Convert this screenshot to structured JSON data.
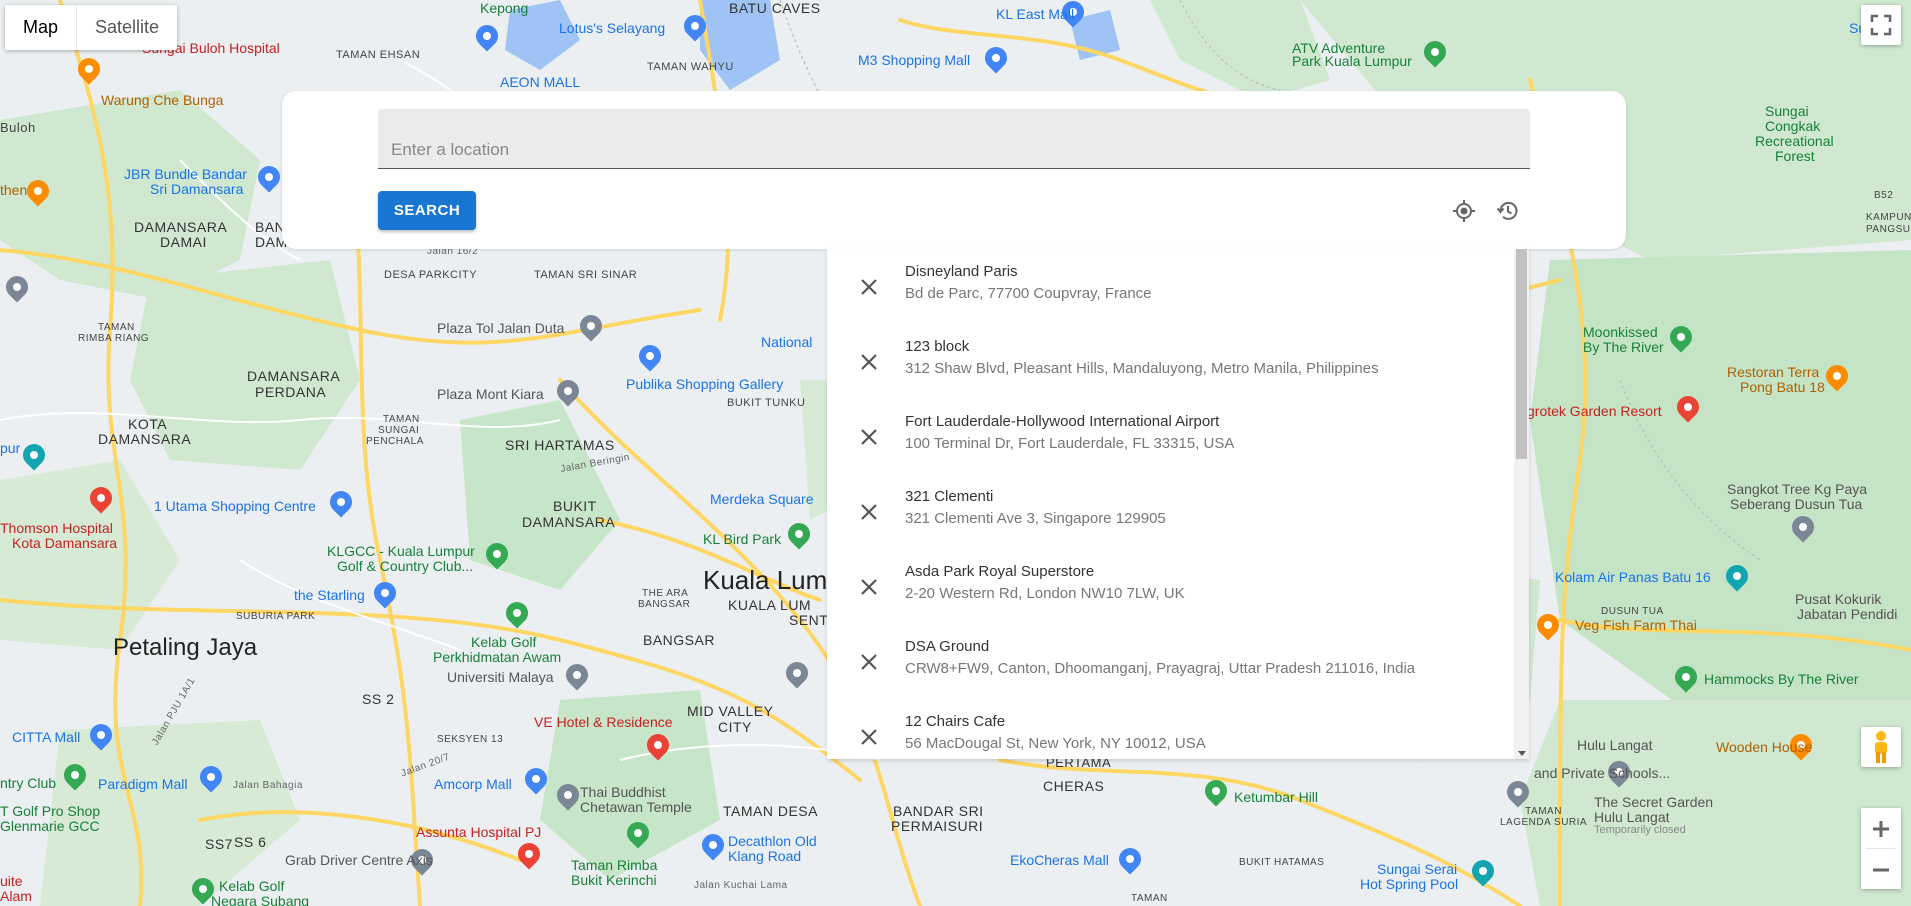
{
  "map": {
    "type_controls": {
      "map_label": "Map",
      "satellite_label": "Satellite"
    },
    "labels": {
      "kepong": "Kepong",
      "lotus_selayang": "Lotus's Selayang",
      "batu_caves": "BATU CAVES",
      "kl_east_mall": "KL East Mall",
      "sunga": "Sunga",
      "sungai_buloh_hospital": "Sungai Buloh Hospital",
      "taman_ehsan": "TAMAN EHSAN",
      "taman_wahyu": "TAMAN WAHYU",
      "m3_shopping_mall": "M3 Shopping Mall",
      "atv_adventure": "ATV Adventure",
      "park_kuala_lumpur": "Park Kuala Lumpur",
      "warung_che_bunga": "Warung Che Bunga",
      "aeon_mall": "AEON MALL",
      "buloh": "Buloh",
      "sungai_congkak_1": "Sungai",
      "sungai_congkak_2": "Congkak",
      "sungai_congkak_3": "Recreational",
      "sungai_congkak_4": "Forest",
      "jbr_bundle_1": "JBR Bundle Bandar",
      "jbr_bundle_2": "Sri Damansara",
      "then": "then",
      "damansara_damai_1": "DAMANSARA",
      "damansara_damai_2": "DAMAI",
      "ban": "BAN",
      "dam": "DAM",
      "b52": "B52",
      "kampung_pangsun_1": "KAMPUNG",
      "kampung_pangsun_2": "PANGSUN",
      "desa_parkcity": "DESA PARKCITY",
      "taman_sri_sinar": "TAMAN SRI SINAR",
      "jalan_16_2": "Jalan 16/2",
      "taman_rimba_riang_1": "TAMAN",
      "taman_rimba_riang_2": "RIMBA RIANG",
      "plaza_tol_jalan_duta": "Plaza Tol Jalan Duta",
      "national": "National",
      "moonkissed_1": "Moonkissed",
      "moonkissed_2": "By The River",
      "restoran_terra_1": "Restoran Terra",
      "restoran_terra_2": "Pong Batu 18",
      "damansara_perdana_1": "DAMANSARA",
      "damansara_perdana_2": "PERDANA",
      "publika": "Publika Shopping Gallery",
      "plaza_mont_kiara": "Plaza Mont Kiara",
      "bukit_tunku": "BUKIT TUNKU",
      "agrotek": "grotek Garden Resort",
      "kota_damansara_1": "KOTA",
      "kota_damansara_2": "DAMANSARA",
      "taman_sungai_penchala_1": "TAMAN",
      "taman_sungai_penchala_2": "SUNGAI",
      "taman_sungai_penchala_3": "PENCHALA",
      "sri_hartamas": "SRI HARTAMAS",
      "jalan_beringin": "Jalan Beringin",
      "pur": "pur",
      "merdeka_square": "Merdeka Square",
      "sangkot_1": "Sangkot Tree Kg Paya",
      "sangkot_2": "Seberang Dusun Tua",
      "bukit_damansara_1": "BUKIT",
      "bukit_damansara_2": "DAMANSARA",
      "utama": "1 Utama Shopping Centre",
      "thomson_1": "Thomson Hospital",
      "thomson_2": "Kota Damansara",
      "kl_bird_park": "KL Bird Park",
      "kolam_air_panas": "Kolam Air Panas Batu 16",
      "klgcc_1": "KLGCC - Kuala Lumpur",
      "klgcc_2": "Golf & Country Club...",
      "kuala_lumpur": "Kuala Lum",
      "kuala_lumpur_sentral_1": "KUALA LUM",
      "kuala_lumpur_sentral_2": "SENTRAL",
      "the_ara_1": "THE ARA",
      "the_ara_2": "BANGSAR",
      "the_starling": "the Starling",
      "dusun_tua": "DUSUN TUA",
      "pusat_kokurik_1": "Pusat Kokurik",
      "pusat_kokurik_2": "Jabatan Pendidi",
      "subang_park": "SUBURIA PARK",
      "petaling_jaya": "Petaling Jaya",
      "kelab_golf_1": "Kelab Golf",
      "kelab_golf_2": "Perkhidmatan Awam",
      "bangsar": "BANGSAR",
      "veg_fish_farm": "Veg Fish Farm Thai",
      "universiti_malaya": "Universiti Malaya",
      "hammocks": "Hammocks By The River",
      "ss2": "SS 2",
      "jalan_pju": "Jalan PJU 1A/1",
      "mid_valley_1": "MID VALLEY",
      "mid_valley_2": "CITY",
      "ve_hotel": "VE Hotel & Residence",
      "citta_mall": "CITTA Mall",
      "seksyen_13": "SEKSYEN 13",
      "hulu_langat": "Hulu Langat",
      "wooden_house": "Wooden House",
      "ntry_club": "ntry Club",
      "paradigm_mall": "Paradigm Mall",
      "amcorp_mall": "Amcorp Mall",
      "jalan_20_7": "Jalan 20/7",
      "cheras": "CHERAS",
      "pertama": "PERTAMA",
      "thai_buddhist_1": "Thai Buddhist",
      "thai_buddhist_2": "Chetawan Temple",
      "and_private_schools": "and Private Schools...",
      "golf_pro_shop_1": "T Golf Pro Shop",
      "golf_pro_shop_2": "Glenmarie GCC",
      "jalan_bahagia": "Jalan Bahagia",
      "taman_desa": "TAMAN DESA",
      "bandar_sri_1": "BANDAR SRI",
      "bandar_sri_2": "PERMAISURI",
      "ketumbar_hill": "Ketumbar Hill",
      "secret_garden_1": "The Secret Garden",
      "secret_garden_2": "Hulu Langat",
      "secret_garden_3": "Temporarily closed",
      "taman_lagenda": "TAMAN\nLAGENDA SURIA",
      "ss7": "SS7",
      "ss6": "SS 6",
      "assunta": "Assunta Hospital PJ",
      "decathlon_1": "Decathlon Old",
      "decathlon_2": "Klang Road",
      "grab_driver": "Grab Driver Centre Axis",
      "taman_rimba_1": "Taman Rimba",
      "taman_rimba_2": "Bukit Kerinchi",
      "ekocheras": "EkoCheras Mall",
      "bukit_hatamas": "BUKIT HATAMAS",
      "sungai_serai_1": "Sungai Serai",
      "sungai_serai_2": "Hot Spring Pool",
      "jalan_kuchai_lama": "Jalan Kuchai Lama",
      "kelab_golf_negara_1": "Kelab Golf",
      "kelab_golf_negara_2": "Negara Subang",
      "uite": "uite",
      "alam": "Alam",
      "taman_bottom": "TAMAN"
    }
  },
  "search": {
    "placeholder": "Enter a location",
    "button_label": "SEARCH"
  },
  "recent": [
    {
      "name": "Disneyland Paris",
      "address": "Bd de Parc, 77700 Coupvray, France"
    },
    {
      "name": "123 block",
      "address": "312 Shaw Blvd, Pleasant Hills, Mandaluyong, Metro Manila, Philippines"
    },
    {
      "name": "Fort Lauderdale-Hollywood International Airport",
      "address": "100 Terminal Dr, Fort Lauderdale, FL 33315, USA"
    },
    {
      "name": "321 Clementi",
      "address": "321 Clementi Ave 3, Singapore 129905"
    },
    {
      "name": "Asda Park Royal Superstore",
      "address": "2-20 Western Rd, London NW10 7LW, UK"
    },
    {
      "name": "DSA Ground",
      "address": "CRW8+FW9, Canton, Dhoomanganj, Prayagraj, Uttar Pradesh 211016, India"
    },
    {
      "name": "12 Chairs Cafe",
      "address": "56 MacDougal St, New York, NY 10012, USA"
    }
  ],
  "icons": {
    "fullscreen": "fullscreen-icon",
    "my_location": "my-location-icon",
    "history": "history-icon",
    "remove": "close-icon",
    "pegman": "pegman-icon",
    "zoom_in": "plus-icon",
    "zoom_out": "minus-icon"
  },
  "colors": {
    "search_button": "#1976d2",
    "map_background": "#eceff1",
    "park_green": "#c8e6c9",
    "road_yellow": "#fdd663",
    "water_blue": "#9fc3f4"
  }
}
